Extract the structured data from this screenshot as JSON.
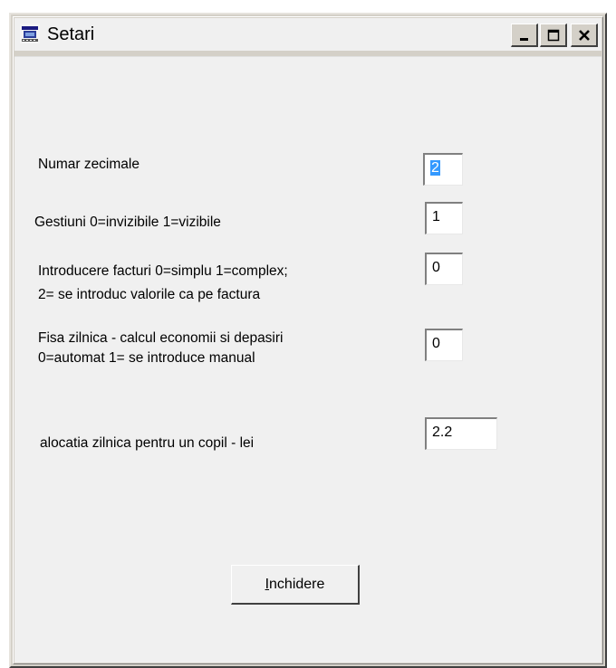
{
  "window": {
    "title": "Setari",
    "icon": "app-icon"
  },
  "titlebar_buttons": {
    "minimize": "minimize-icon",
    "maximize": "maximize-icon",
    "close": "close-icon"
  },
  "settings": {
    "decimals": {
      "label": "Numar zecimale",
      "value": "2"
    },
    "gestiuni": {
      "label": "Gestiuni 0=invizibile 1=vizibile",
      "value": "1"
    },
    "facturi": {
      "label_line1": "Introducere facturi  0=simplu 1=complex;",
      "label_line2": "2= se introduc valorile ca pe factura",
      "value": "0"
    },
    "fisa": {
      "label_line1": "Fisa zilnica - calcul economii si depasiri",
      "label_line2": "0=automat 1= se introduce manual",
      "value": "0"
    },
    "alocatie": {
      "label": "alocatia zilnica pentru un copil - lei",
      "value": "2.2"
    }
  },
  "close_button": {
    "mnemonic": "I",
    "rest": "nchidere"
  },
  "colors": {
    "selection": "#3399ff",
    "client_bg": "#f0f0f0",
    "frame": "#d4d0c8"
  }
}
